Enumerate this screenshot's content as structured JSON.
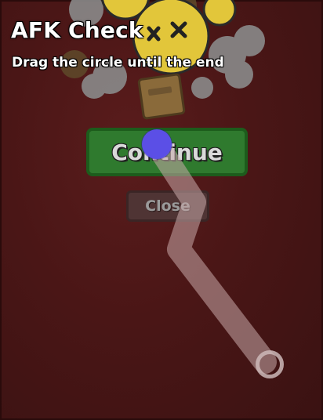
{
  "dialog": {
    "title": "AFK Check",
    "instruction": "Drag the circle until the end",
    "continue_label": "Continue",
    "close_label": "Close"
  },
  "colors": {
    "background": "#4a1616",
    "continue_button": "#2f7a2e",
    "close_button": "#4f3434",
    "drag_handle": "#5b4fe6",
    "track": "#c9aaaa"
  },
  "icons": {
    "mob_art": "dead-player-face-icon",
    "drag_handle": "drag-circle-icon",
    "path_end": "target-ring-icon"
  }
}
